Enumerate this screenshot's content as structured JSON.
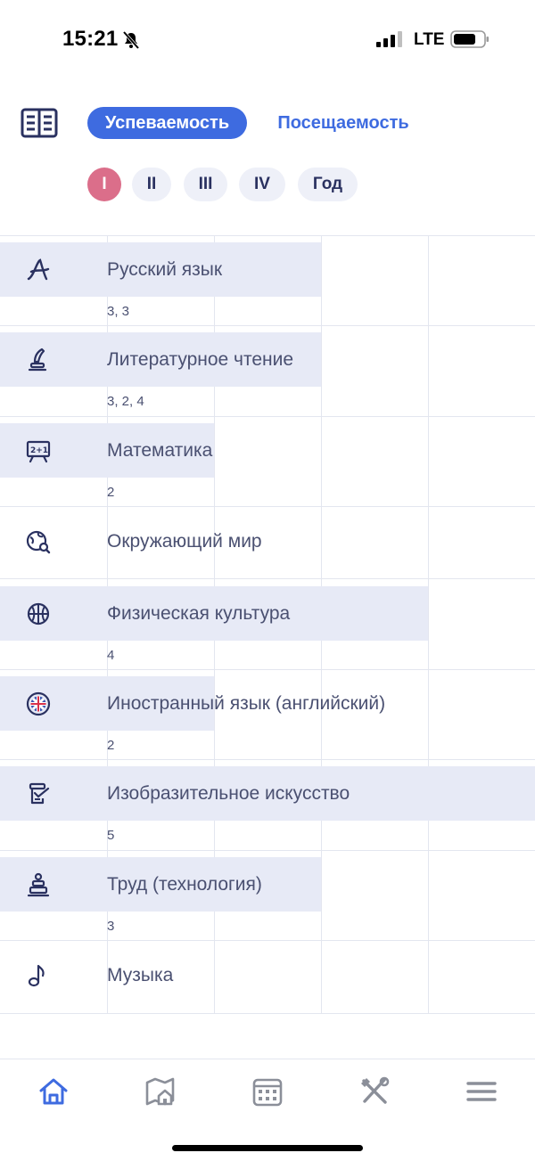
{
  "status_bar": {
    "time": "15:21",
    "network": "LTE"
  },
  "tabs": [
    {
      "label": "Успеваемость",
      "active": true
    },
    {
      "label": "Посещаемость",
      "active": false
    }
  ],
  "quarters": [
    {
      "label": "I",
      "selected": true
    },
    {
      "label": "II",
      "selected": false
    },
    {
      "label": "III",
      "selected": false
    },
    {
      "label": "IV",
      "selected": false
    },
    {
      "label": "Год",
      "selected": false
    }
  ],
  "subjects": [
    {
      "name": "Русский язык",
      "icon": "letter-a-icon",
      "grades": "3, 3",
      "band_fraction": 0.6
    },
    {
      "name": "Литературное чтение",
      "icon": "quill-pen-icon",
      "grades": "3, 2, 4",
      "band_fraction": 0.6
    },
    {
      "name": "Математика",
      "icon": "math-board-icon",
      "grades": "2",
      "band_fraction": 0.4
    },
    {
      "name": "Окружающий мир",
      "icon": "globe-search-icon",
      "grades": "",
      "band_fraction": 0
    },
    {
      "name": "Физическая культура",
      "icon": "basketball-icon",
      "grades": "4",
      "band_fraction": 0.8
    },
    {
      "name": "Иностранный язык (английский)",
      "icon": "uk-flag-icon",
      "grades": "2",
      "band_fraction": 0.4
    },
    {
      "name": "Изобразительное искусство",
      "icon": "art-easel-icon",
      "grades": "5",
      "band_fraction": 1.0
    },
    {
      "name": "Труд (технология)",
      "icon": "crafts-icon",
      "grades": "3",
      "band_fraction": 0.6
    },
    {
      "name": "Музыка",
      "icon": "music-note-icon",
      "grades": "",
      "band_fraction": 0
    }
  ],
  "bottom_nav": [
    {
      "name": "home-icon",
      "active": true
    },
    {
      "name": "school-map-icon",
      "active": false
    },
    {
      "name": "calendar-icon",
      "active": false
    },
    {
      "name": "tools-icon",
      "active": false
    },
    {
      "name": "menu-icon",
      "active": false
    }
  ],
  "colors": {
    "accent": "#3e6be0",
    "selected_quarter": "#db6e8a",
    "row_band": "#e7eaf6",
    "text": "#4a5071",
    "icon": "#2a3160",
    "nav_inactive": "#8b8f99"
  }
}
